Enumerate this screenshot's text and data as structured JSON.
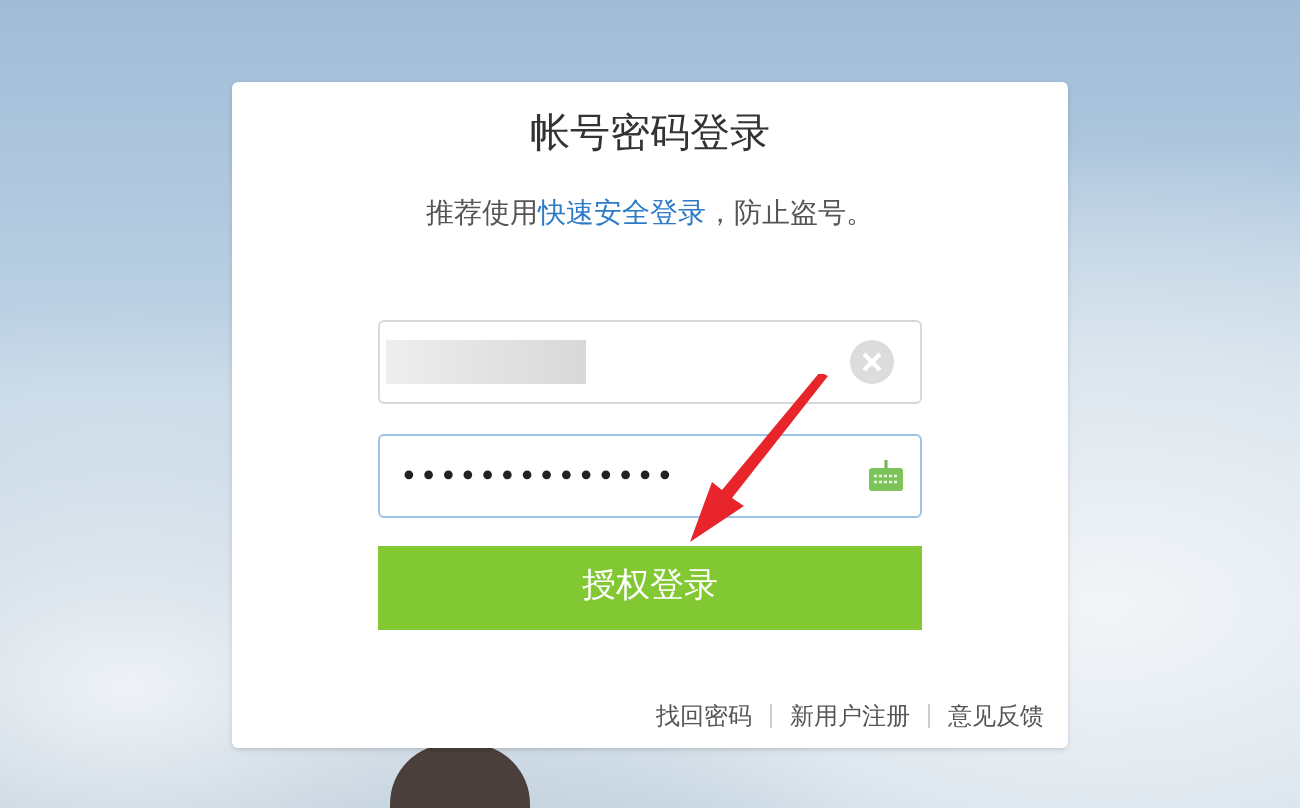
{
  "title": "帐号密码登录",
  "notice": {
    "before": "推荐使用",
    "link": "快速安全登录",
    "after": "，防止盗号。"
  },
  "username": {
    "redacted": true
  },
  "password": {
    "value": "••••••••••••••"
  },
  "submit": "授权登录",
  "footer_links": [
    "找回密码",
    "新用户注册",
    "意见反馈"
  ]
}
